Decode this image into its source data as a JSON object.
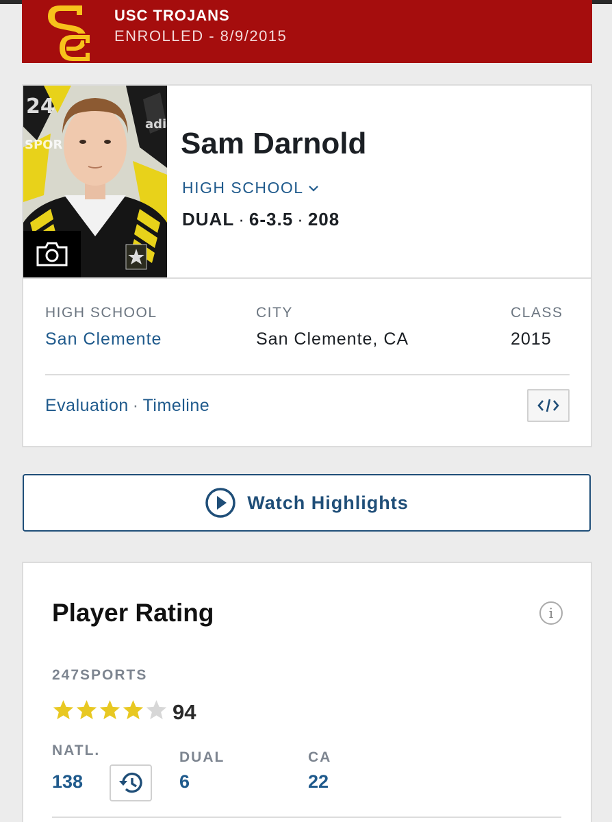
{
  "colors": {
    "usc_red": "#a50d0d",
    "usc_gold": "#f7c21b",
    "link_blue": "#1f5a8c",
    "star_gold": "#e8c822",
    "star_empty": "#d7d7d7"
  },
  "banner": {
    "team": "USC TROJANS",
    "status": "ENROLLED - 8/9/2015",
    "logo_icon": "usc-sc-logo"
  },
  "player": {
    "name": "Sam Darnold",
    "level_selector": "HIGH SCHOOL",
    "position": "DUAL",
    "height": "6-3.5",
    "weight": "208",
    "photo_icon": "camera-icon"
  },
  "details": {
    "school_label": "HIGH SCHOOL",
    "school_value": "San Clemente",
    "city_label": "CITY",
    "city_value": "San Clemente, CA",
    "class_label": "CLASS",
    "class_value": "2015"
  },
  "links": {
    "evaluation": "Evaluation",
    "timeline": "Timeline",
    "embed_icon": "code-embed-icon"
  },
  "highlights": {
    "label": "Watch Highlights",
    "icon": "play-circle-icon"
  },
  "rating": {
    "title": "Player Rating",
    "source": "247SPORTS",
    "stars": 4,
    "stars_max": 5,
    "score": "94",
    "natl_label": "NATL.",
    "natl_value": "138",
    "pos_label": "DUAL",
    "pos_value": "6",
    "state_label": "CA",
    "state_value": "22"
  }
}
